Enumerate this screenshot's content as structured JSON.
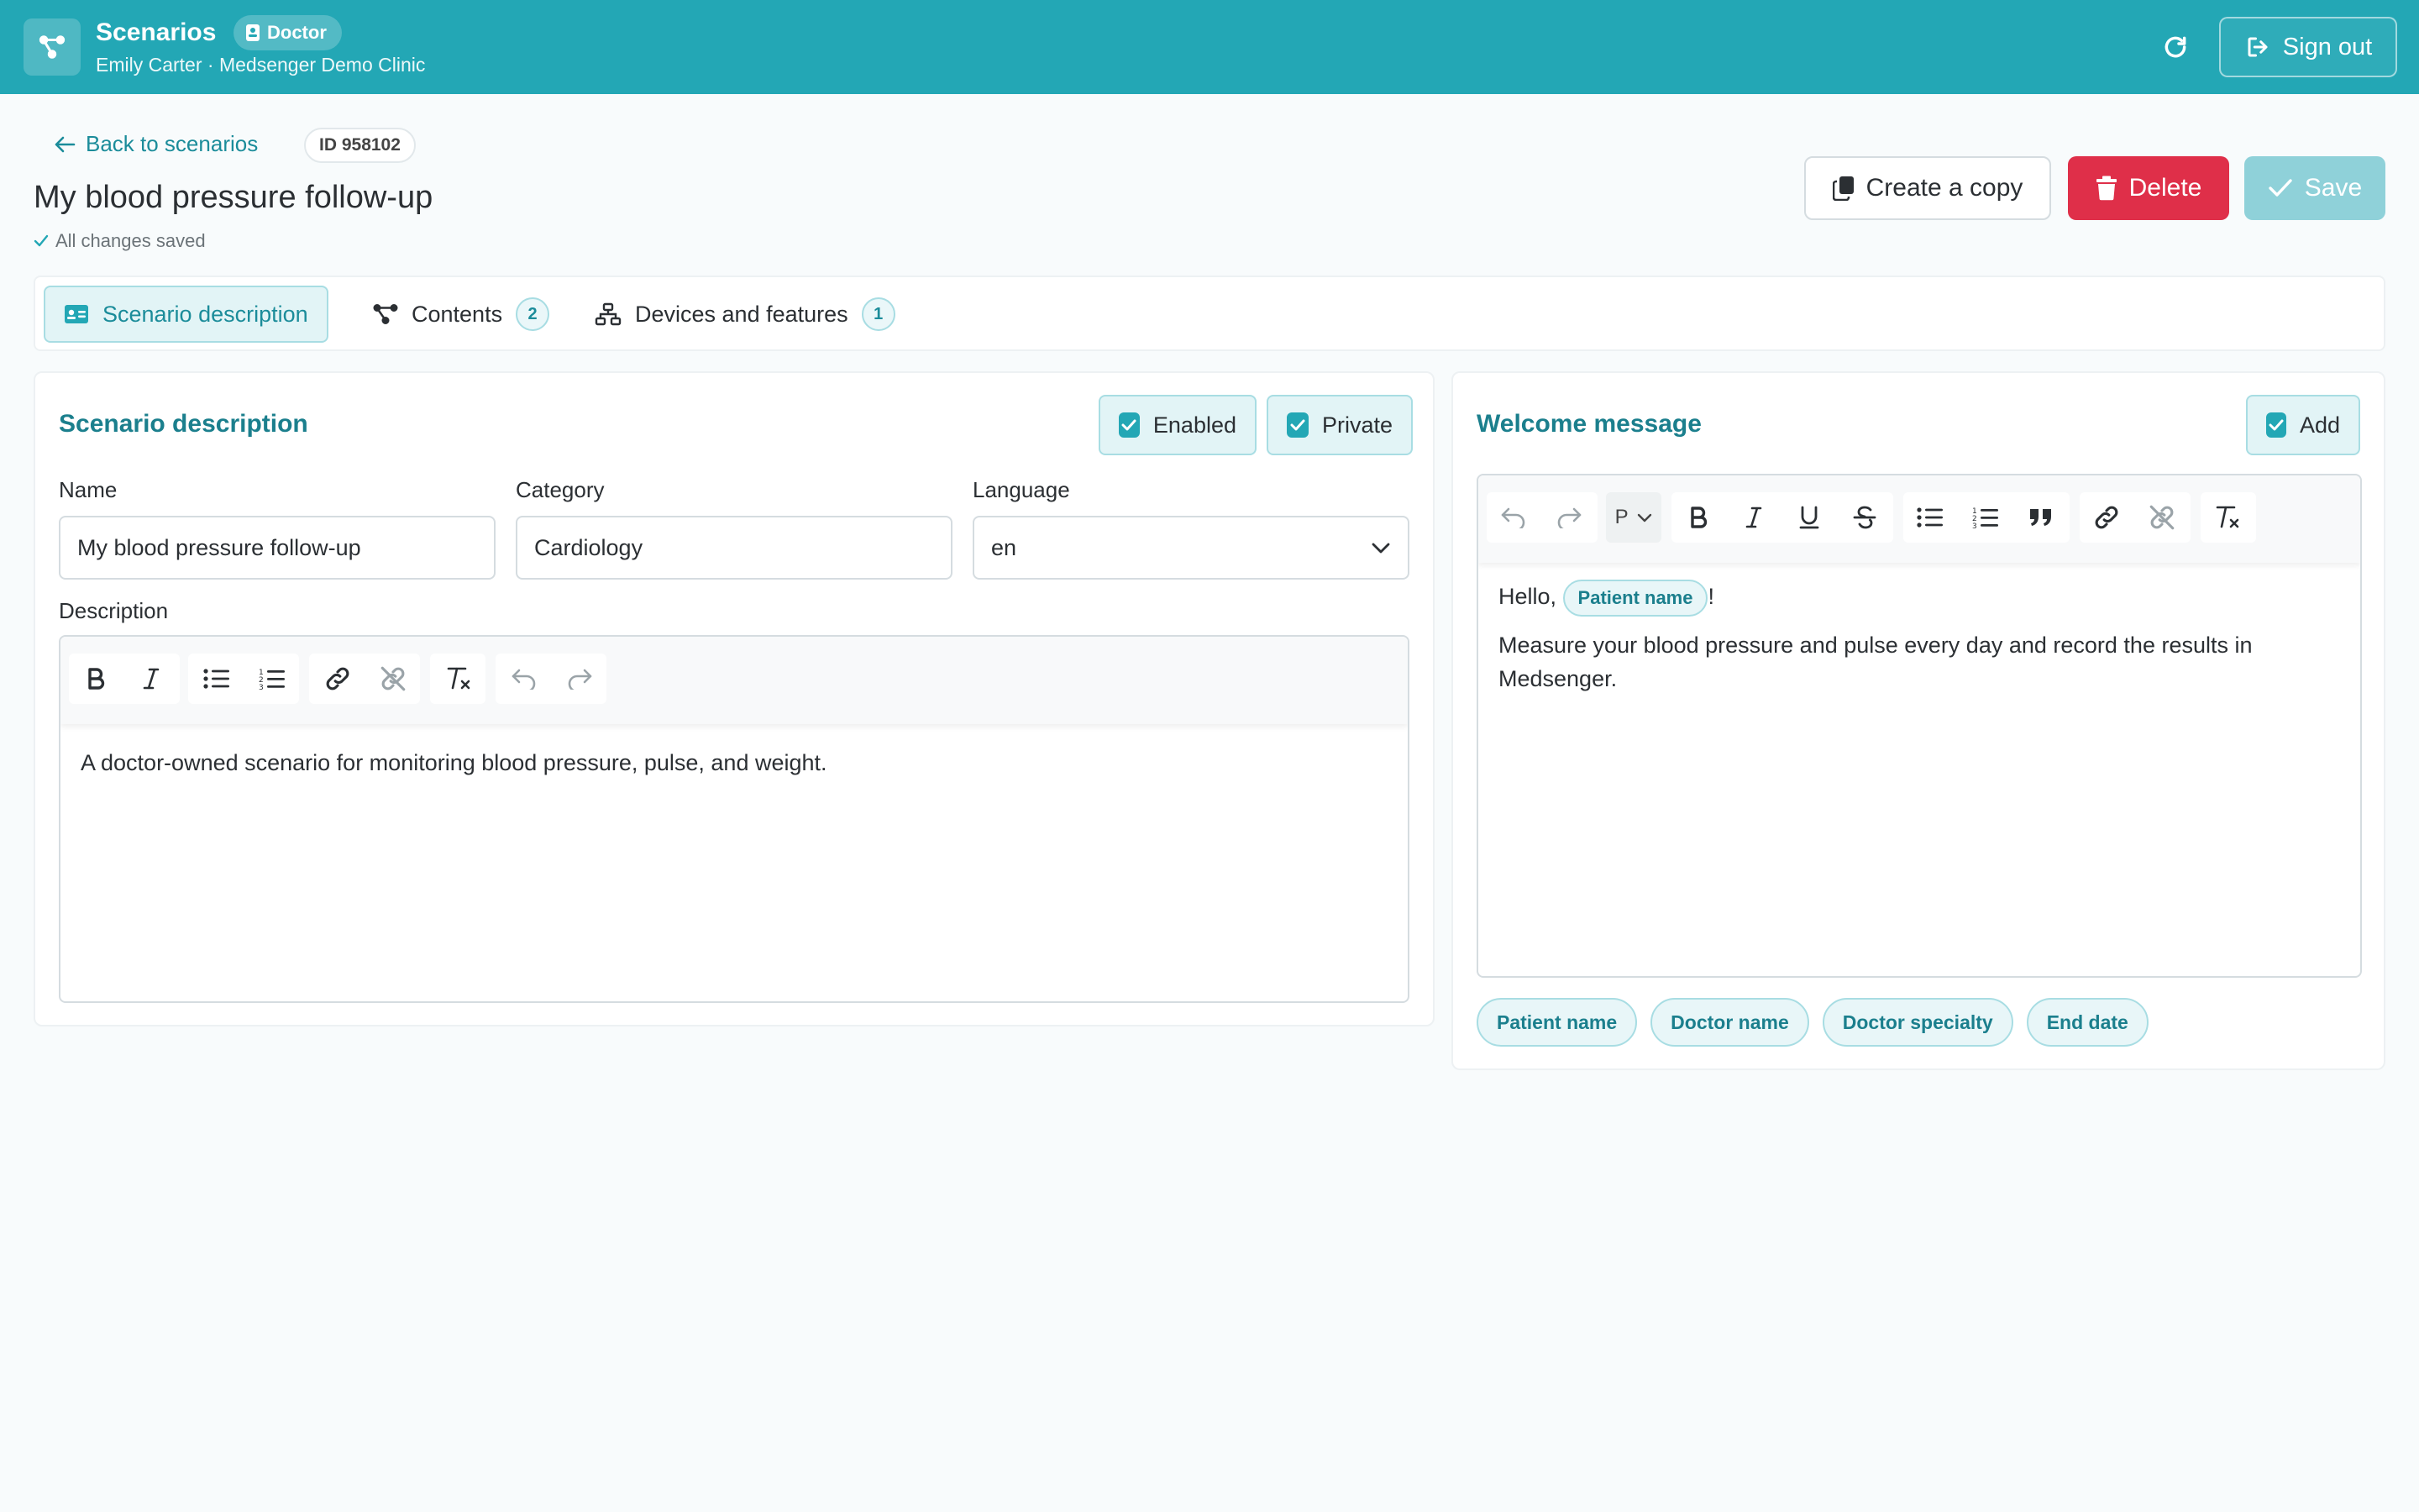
{
  "header": {
    "app_title": "Scenarios",
    "role_badge": "Doctor",
    "user_line": "Emily Carter · Medsenger Demo Clinic",
    "sign_out_label": "Sign out"
  },
  "page": {
    "back_label": "Back to scenarios",
    "id_badge": "ID 958102",
    "title": "My blood pressure follow-up",
    "save_status": "All changes saved",
    "copy_label": "Create a copy",
    "delete_label": "Delete",
    "save_label": "Save"
  },
  "tabs": [
    {
      "label": "Scenario description",
      "count": ""
    },
    {
      "label": "Contents",
      "count": "2"
    },
    {
      "label": "Devices and features",
      "count": "1"
    }
  ],
  "description_card": {
    "title": "Scenario description",
    "enabled_label": "Enabled",
    "private_label": "Private",
    "name_label": "Name",
    "name_value": "My blood pressure follow-up",
    "category_label": "Category",
    "category_value": "Cardiology",
    "language_label": "Language",
    "language_value": "en",
    "description_label": "Description",
    "description_text": "A doctor-owned scenario for monitoring blood pressure, pulse, and weight."
  },
  "welcome_card": {
    "title": "Welcome message",
    "add_label": "Add",
    "format_select": "P",
    "greeting": "Hello,",
    "greeting_chip": "Patient name",
    "greeting_end": "!",
    "body_text": "Measure your blood pressure and pulse every day and record the results in Medsenger.",
    "chips": [
      "Patient name",
      "Doctor name",
      "Doctor specialty",
      "End date"
    ]
  },
  "colors": {
    "brand": "#23a7b5",
    "accent_text": "#1b7f8d",
    "danger": "#df2f49",
    "save_disabled": "#8fd1d9"
  }
}
